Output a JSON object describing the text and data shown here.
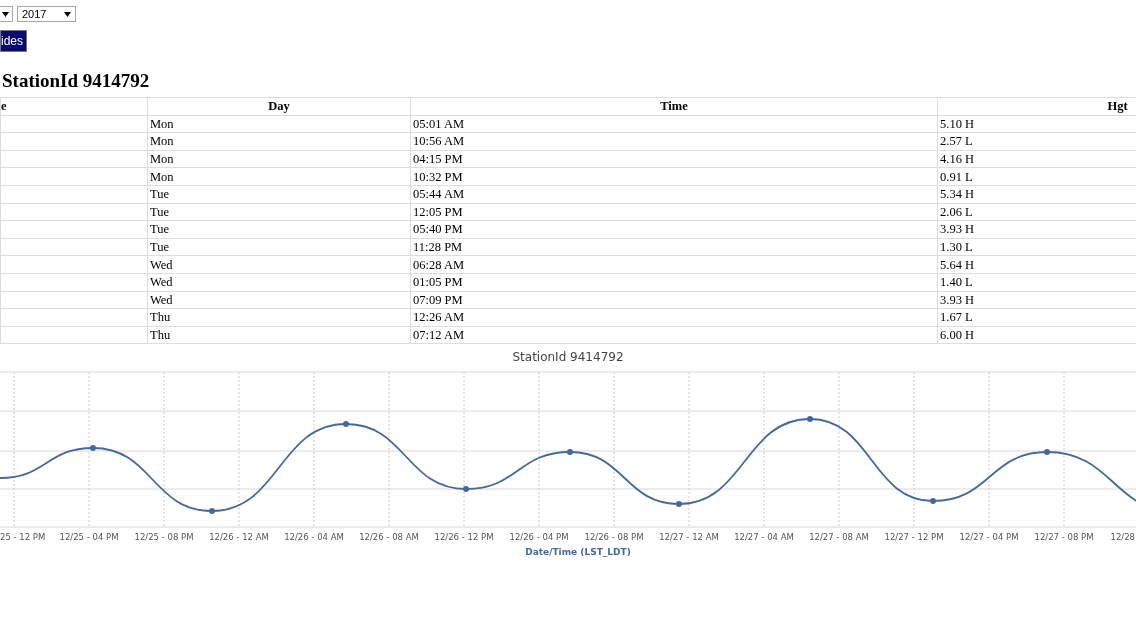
{
  "year_select": {
    "value": "2017"
  },
  "button": {
    "label": "ides"
  },
  "heading": "StationId 9414792",
  "table": {
    "columns": [
      "e",
      "Day",
      "Time",
      "Hgt"
    ],
    "rows": [
      {
        "day": "Mon",
        "time": "05:01 AM",
        "hgt": "5.10 H"
      },
      {
        "day": "Mon",
        "time": "10:56 AM",
        "hgt": "2.57 L"
      },
      {
        "day": "Mon",
        "time": "04:15 PM",
        "hgt": "4.16 H"
      },
      {
        "day": "Mon",
        "time": "10:32 PM",
        "hgt": "0.91 L"
      },
      {
        "day": "Tue",
        "time": "05:44 AM",
        "hgt": "5.34 H"
      },
      {
        "day": "Tue",
        "time": "12:05 PM",
        "hgt": "2.06 L"
      },
      {
        "day": "Tue",
        "time": "05:40 PM",
        "hgt": "3.93 H"
      },
      {
        "day": "Tue",
        "time": "11:28 PM",
        "hgt": "1.30 L"
      },
      {
        "day": "Wed",
        "time": "06:28 AM",
        "hgt": "5.64 H"
      },
      {
        "day": "Wed",
        "time": "01:05 PM",
        "hgt": "1.40 L"
      },
      {
        "day": "Wed",
        "time": "07:09 PM",
        "hgt": "3.93 H"
      },
      {
        "day": "Thu",
        "time": "12:26 AM",
        "hgt": "1.67 L"
      },
      {
        "day": "Thu",
        "time": "07:12 AM",
        "hgt": "6.00 H"
      }
    ]
  },
  "chart": {
    "title": "StationId 9414792",
    "x_axis_title": "Date/Time (LST_LDT)",
    "x_labels": [
      "25 - 12 PM",
      "12/25 - 04 PM",
      "12/25 - 08 PM",
      "12/26 - 12 AM",
      "12/26 - 04 AM",
      "12/26 - 08 AM",
      "12/26 - 12 PM",
      "12/26 - 04 PM",
      "12/26 - 08 PM",
      "12/27 - 12 AM",
      "12/27 - 04 AM",
      "12/27 - 08 AM",
      "12/27 - 12 PM",
      "12/27 - 04 PM",
      "12/27 - 08 PM",
      "12/28"
    ]
  }
}
